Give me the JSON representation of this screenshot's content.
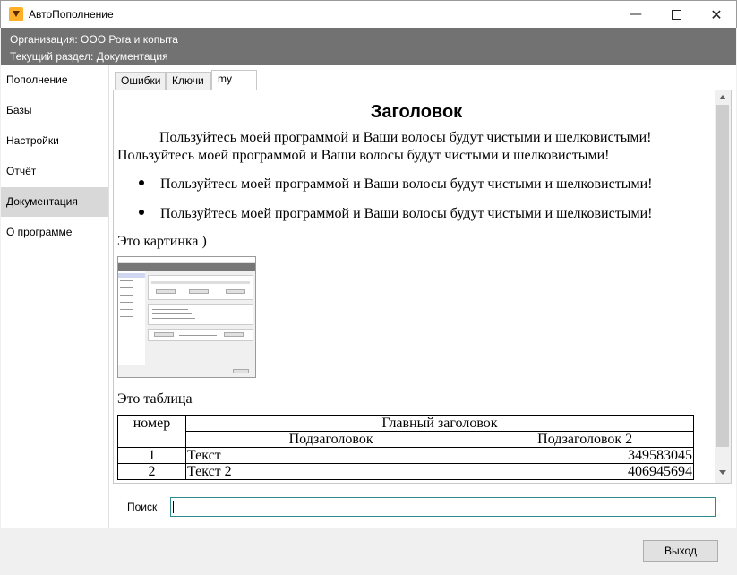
{
  "window": {
    "title": "АвтоПополнение",
    "min_glyph": "—",
    "close_glyph": "✕"
  },
  "header": {
    "organization": "Организация: ООО Рога и копыта",
    "section": "Текущий раздел: Документация"
  },
  "sidebar": {
    "items": [
      {
        "label": "Пополнение"
      },
      {
        "label": "Базы"
      },
      {
        "label": "Настройки"
      },
      {
        "label": "Отчёт"
      },
      {
        "label": "Документация",
        "active": true
      },
      {
        "label": "О программе"
      }
    ]
  },
  "tabs": [
    {
      "label": "Ошибки"
    },
    {
      "label": "Ключи"
    },
    {
      "label": "my",
      "active": true
    }
  ],
  "document": {
    "title": "Заголовок",
    "paragraph": "Пользуйтесь моей программой и Ваши волосы будут чистыми и шелковистыми!",
    "bullets": [
      "Пользуйтесь моей программой и Ваши волосы будут чистыми и шелковистыми!",
      "Пользуйтесь моей программой и Ваши волосы будут чистыми и шелковистыми!"
    ],
    "picture_caption": "Это картинка )",
    "table_caption": "Это таблица",
    "table": {
      "col_num": "номер",
      "main_header": "Главный заголовок",
      "sub1": "Подзаголовок",
      "sub2": "Подзаголовок 2",
      "rows": [
        {
          "num": "1",
          "text": "Текст",
          "value": "349583045"
        },
        {
          "num": "2",
          "text": "Текст 2",
          "value": "406945694"
        }
      ]
    }
  },
  "search": {
    "label": "Поиск",
    "value": ""
  },
  "footer": {
    "exit_label": "Выход"
  },
  "colors": {
    "header_bg": "#727272",
    "active_item": "#d8d8d8",
    "search_border": "#2f8a8c"
  }
}
